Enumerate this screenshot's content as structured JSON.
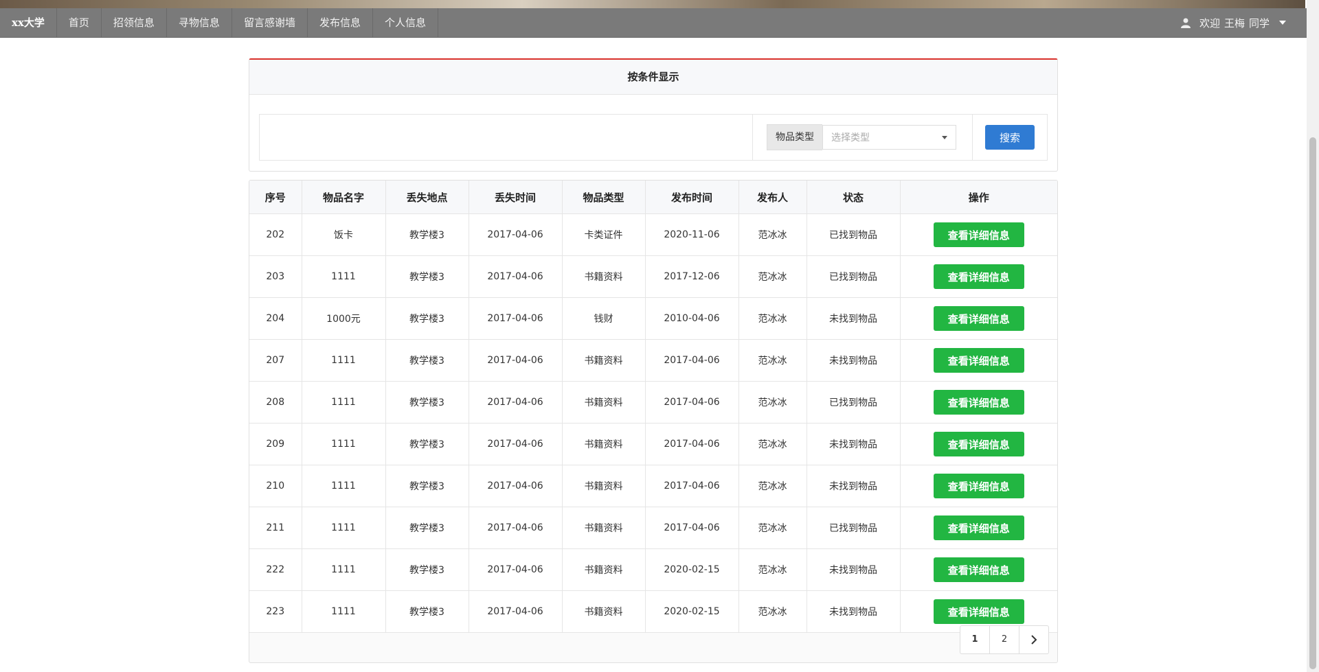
{
  "navbar": {
    "brand": "xx大学",
    "items": [
      "首页",
      "招领信息",
      "寻物信息",
      "留言感谢墙",
      "发布信息",
      "个人信息"
    ],
    "welcome": "欢迎",
    "user_name": "王梅",
    "user_role": "同学"
  },
  "search_panel": {
    "heading": "按条件显示",
    "filter_label": "物品类型",
    "filter_placeholder": "选择类型",
    "search_button": "搜索"
  },
  "table": {
    "headers": [
      "序号",
      "物品名字",
      "丢失地点",
      "丢失时间",
      "物品类型",
      "发布时间",
      "发布人",
      "状态",
      "操作"
    ],
    "action_label": "查看详细信息",
    "rows": [
      [
        "202",
        "饭卡",
        "教学楼3",
        "2017-04-06",
        "卡类证件",
        "2020-11-06",
        "范冰冰",
        "已找到物品"
      ],
      [
        "203",
        "1111",
        "教学楼3",
        "2017-04-06",
        "书籍资料",
        "2017-12-06",
        "范冰冰",
        "已找到物品"
      ],
      [
        "204",
        "1000元",
        "教学楼3",
        "2017-04-06",
        "钱财",
        "2010-04-06",
        "范冰冰",
        "未找到物品"
      ],
      [
        "207",
        "1111",
        "教学楼3",
        "2017-04-06",
        "书籍资料",
        "2017-04-06",
        "范冰冰",
        "未找到物品"
      ],
      [
        "208",
        "1111",
        "教学楼3",
        "2017-04-06",
        "书籍资料",
        "2017-04-06",
        "范冰冰",
        "已找到物品"
      ],
      [
        "209",
        "1111",
        "教学楼3",
        "2017-04-06",
        "书籍资料",
        "2017-04-06",
        "范冰冰",
        "未找到物品"
      ],
      [
        "210",
        "1111",
        "教学楼3",
        "2017-04-06",
        "书籍资料",
        "2017-04-06",
        "范冰冰",
        "未找到物品"
      ],
      [
        "211",
        "1111",
        "教学楼3",
        "2017-04-06",
        "书籍资料",
        "2017-04-06",
        "范冰冰",
        "已找到物品"
      ],
      [
        "222",
        "1111",
        "教学楼3",
        "2017-04-06",
        "书籍资料",
        "2020-02-15",
        "范冰冰",
        "未找到物品"
      ],
      [
        "223",
        "1111",
        "教学楼3",
        "2017-04-06",
        "书籍资料",
        "2020-02-15",
        "范冰冰",
        "未找到物品"
      ]
    ]
  },
  "pagination": {
    "pages": [
      "1",
      "2"
    ],
    "current": "1",
    "next_icon": "chevron-right-icon"
  },
  "colors": {
    "navbar": "#7a7a7a",
    "panel_accent": "#d9302a",
    "search_button": "#2f7bd3",
    "detail_button": "#22b642"
  }
}
